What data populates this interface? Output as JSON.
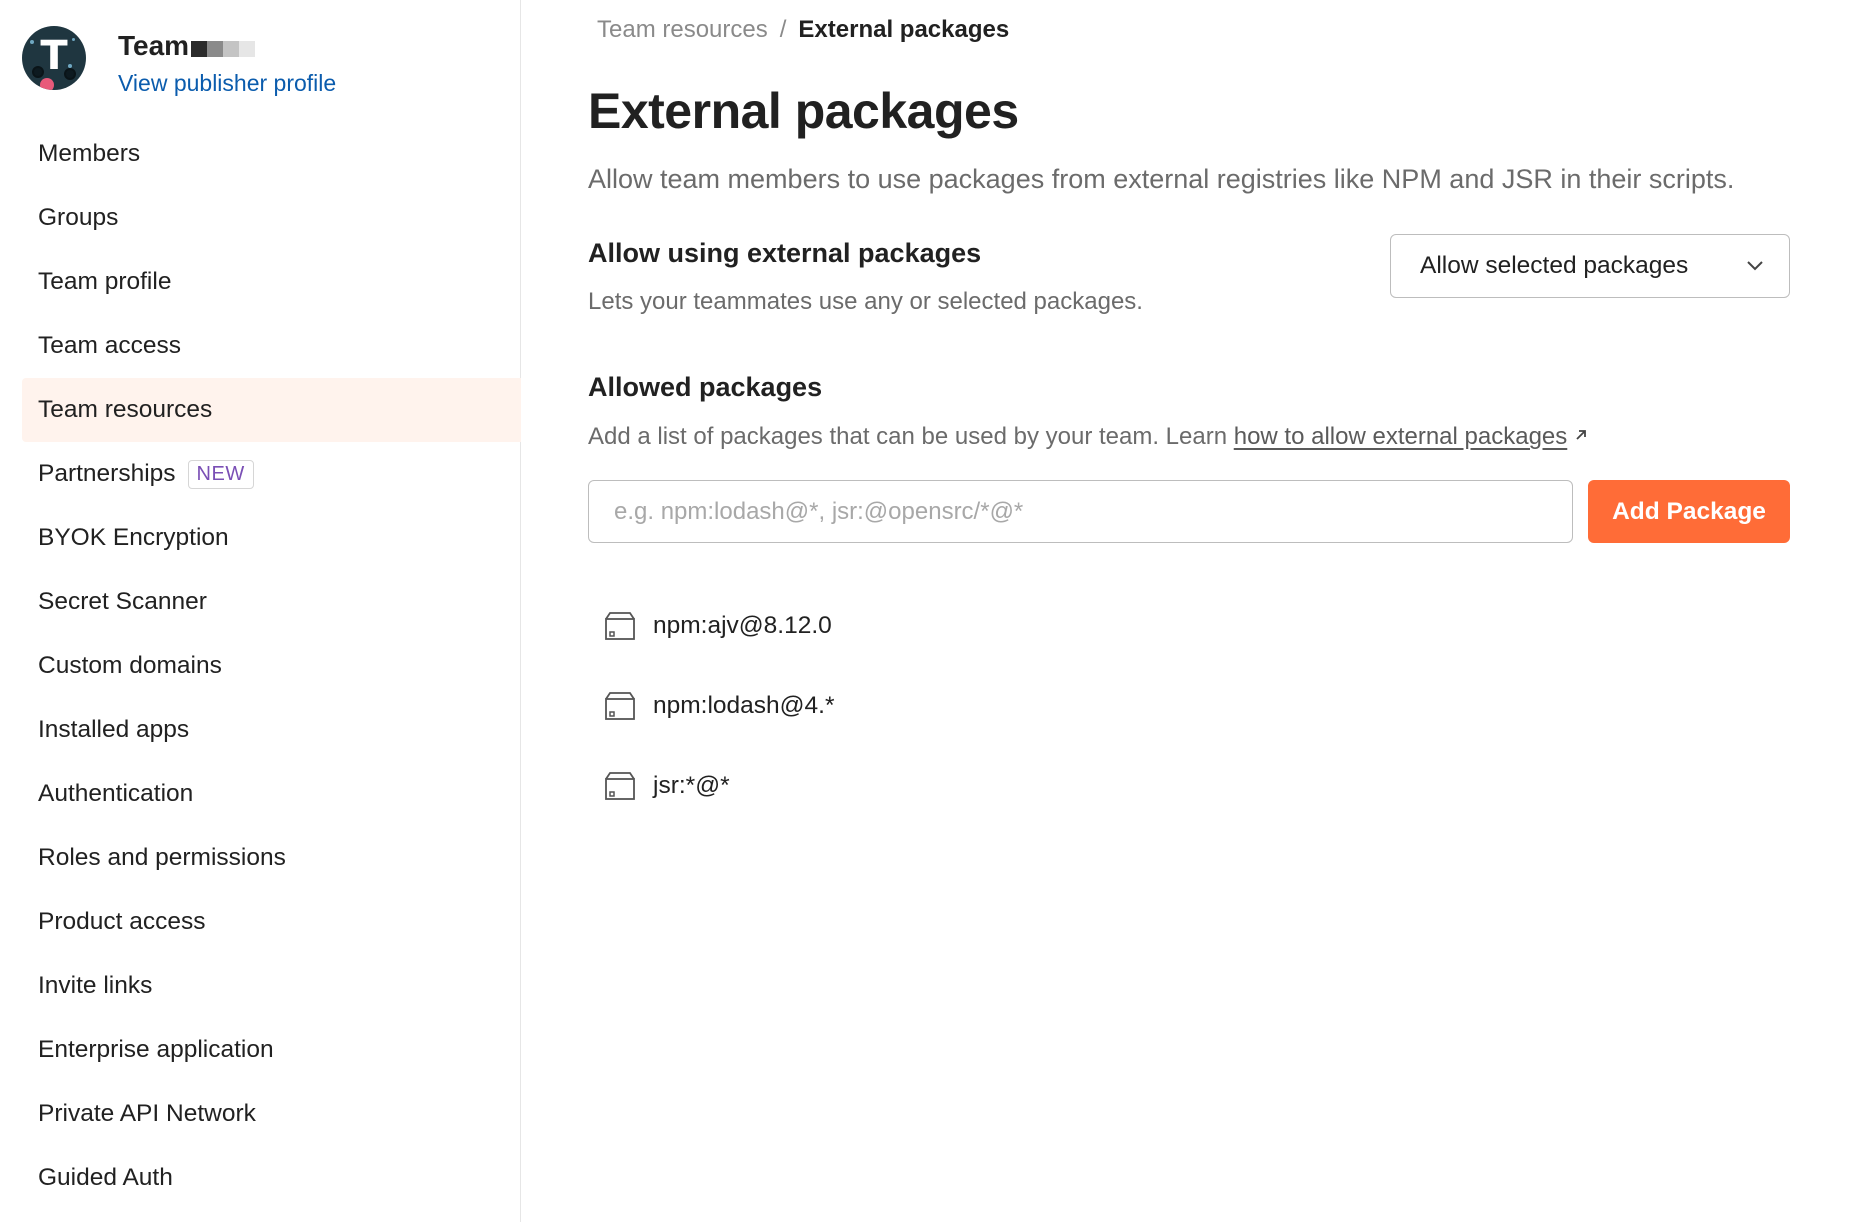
{
  "sidebar": {
    "team_name": "Team",
    "publisher_link": "View publisher profile",
    "avatar_letter": "T",
    "items": [
      {
        "label": "Members"
      },
      {
        "label": "Groups"
      },
      {
        "label": "Team profile"
      },
      {
        "label": "Team access"
      },
      {
        "label": "Team resources",
        "active": true
      },
      {
        "label": "Partnerships",
        "badge": "NEW"
      },
      {
        "label": "BYOK Encryption"
      },
      {
        "label": "Secret Scanner"
      },
      {
        "label": "Custom domains"
      },
      {
        "label": "Installed apps"
      },
      {
        "label": "Authentication"
      },
      {
        "label": "Roles and permissions"
      },
      {
        "label": "Product access"
      },
      {
        "label": "Invite links"
      },
      {
        "label": "Enterprise application"
      },
      {
        "label": "Private API Network"
      },
      {
        "label": "Guided Auth"
      }
    ]
  },
  "breadcrumb": {
    "parent": "Team resources",
    "separator": "/",
    "current": "External packages"
  },
  "page": {
    "title": "External packages",
    "description": "Allow team members to use packages from external registries like NPM and JSR in their scripts."
  },
  "allow_section": {
    "title": "Allow using external packages",
    "description": "Lets your teammates use any or selected packages.",
    "select_value": "Allow selected packages"
  },
  "allowed_section": {
    "title": "Allowed packages",
    "description_prefix": "Add a list of packages that can be used by your team. Learn ",
    "link_text": "how to allow external packages",
    "input_placeholder": "e.g. npm:lodash@*, jsr:@opensrc/*@*",
    "add_button": "Add Package",
    "packages": [
      "npm:ajv@8.12.0",
      "npm:lodash@4.*",
      "jsr:*@*"
    ]
  },
  "colors": {
    "accent": "#ff6c37",
    "link": "#0b5cad",
    "active_nav_bg": "#fff3ed",
    "badge_text": "#7a4fb5"
  },
  "icons": {
    "select_chevron": "chevron-down-icon",
    "external_link": "external-link-icon",
    "package": "package-icon"
  }
}
